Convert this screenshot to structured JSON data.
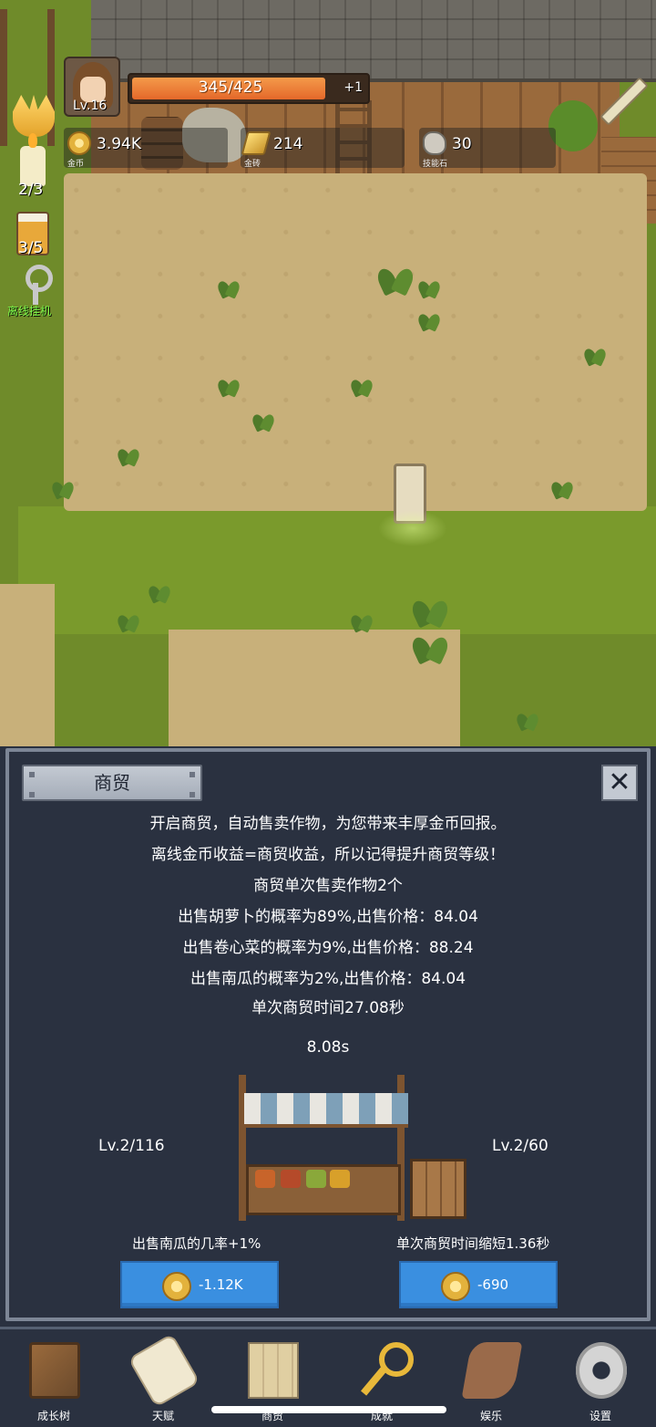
{
  "hud": {
    "level": "Lv.16",
    "hp_text": "345/425",
    "hp_fraction": 0.81,
    "hp_bonus": "+1",
    "resources": [
      {
        "icon": "gold-coin-icon",
        "value": "3.94K",
        "caption": "金币"
      },
      {
        "icon": "gold-brick-icon",
        "value": "214",
        "caption": "金砖"
      },
      {
        "icon": "skill-stone-icon",
        "value": "30",
        "caption": "技能石"
      }
    ],
    "side": {
      "candle_count": "2/3",
      "beer_count": "3/5",
      "afk_label": "离线挂机"
    }
  },
  "panel": {
    "title": "商贸",
    "close_icon": "close-icon",
    "lines": [
      "开启商贸，自动售卖作物，为您带来丰厚金币回报。",
      "离线金币收益=商贸收益，所以记得提升商贸等级！",
      "商贸单次售卖作物2个",
      "出售胡萝卜的概率为89%,出售价格：84.04",
      "出售卷心菜的概率为9%,出售价格：88.24",
      "出售南瓜的概率为2%,出售价格：84.04",
      "单次商贸时间27.08秒"
    ],
    "timer": "8.08s",
    "left_level": "Lv.2/116",
    "right_level": "Lv.2/60",
    "left_upgrade_label": "出售南瓜的几率+1%",
    "right_upgrade_label": "单次商贸时间缩短1.36秒",
    "left_cost": "-1.12K",
    "right_cost": "-690",
    "button_color": "#3a8fe0"
  },
  "nav": {
    "items": [
      {
        "label": "成长树",
        "icon": "book-icon"
      },
      {
        "label": "天赋",
        "icon": "scroll-icon"
      },
      {
        "label": "商贸",
        "icon": "map-icon"
      },
      {
        "label": "成就",
        "icon": "key-icon"
      },
      {
        "label": "娱乐",
        "icon": "fun-icon"
      },
      {
        "label": "设置",
        "icon": "gear-icon"
      }
    ]
  }
}
